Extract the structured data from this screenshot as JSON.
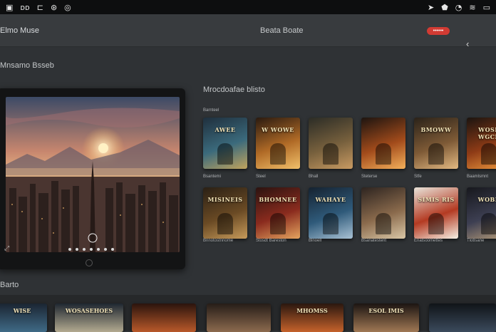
{
  "status_bar": {
    "left_glyphs": [
      "▣",
      "ᴅᴅ",
      "⊏",
      "⊛",
      "◎"
    ],
    "right_glyphs": [
      "➤",
      "⬟",
      "◔",
      "≋",
      "▭"
    ]
  },
  "header": {
    "app_title": "Elmo Muse",
    "center_title": "Beata Boate",
    "badge_label": "••••••"
  },
  "sections": {
    "top_title": "Mnsamo Bsseb",
    "grid_title": "Mrocdoafae blisto",
    "grid_subtitle": "Barnteel",
    "bottom_title": "Barto"
  },
  "row1": [
    {
      "title": "AWEE",
      "caption": "Bsantemi",
      "colors": [
        "#1f2f3d",
        "#3b6a7c",
        "#c0a35d"
      ]
    },
    {
      "title": "W WOWE",
      "caption": "Steel",
      "colors": [
        "#2a1a10",
        "#b06a26",
        "#f1c06a"
      ]
    },
    {
      "title": "",
      "caption": "Bhall",
      "colors": [
        "#2b2c26",
        "#77603d",
        "#c89a62"
      ]
    },
    {
      "title": "",
      "caption": "Steterse",
      "colors": [
        "#1d1410",
        "#a24b1b",
        "#f3b05b"
      ]
    },
    {
      "title": "BMOWW",
      "caption": "Stfe",
      "colors": [
        "#2a2219",
        "#7e5a36",
        "#e2b982"
      ]
    },
    {
      "title": "WOSE WGCE",
      "caption": "Baamlsmnt",
      "colors": [
        "#1b1410",
        "#8e3b16",
        "#ef9a3e"
      ]
    }
  ],
  "row2": [
    {
      "title": "MISINEIS",
      "caption": "Bnnotostnnome",
      "colors": [
        "#2a2015",
        "#6a4a24",
        "#c69a5a"
      ]
    },
    {
      "title": "BHOMNEE",
      "caption": "Stosdt Bareston",
      "colors": [
        "#2b1310",
        "#8a2b1e",
        "#e4a45f"
      ]
    },
    {
      "title": "WAHAYE",
      "caption": "Blnoell",
      "colors": [
        "#152230",
        "#2f5a7a",
        "#a9c2d4"
      ]
    },
    {
      "title": "",
      "caption": "Bsanatestent",
      "colors": [
        "#2d2420",
        "#8a6a4c",
        "#d9c7a6"
      ]
    },
    {
      "title": "SIMIS RIS",
      "caption": "Enatsoomettes",
      "colors": [
        "#e9e4da",
        "#b43a22",
        "#f6f1e5"
      ]
    },
    {
      "title": "WOBE",
      "caption": "Tlotlsane",
      "colors": [
        "#17181d",
        "#3d3f52",
        "#b99e7a"
      ]
    }
  ],
  "bottom_row": [
    {
      "title": "WISE",
      "colors": [
        "#1b2532",
        "#3f6a86"
      ]
    },
    {
      "title": "WOSASEHOES",
      "colors": [
        "#1f2731",
        "#b3aa90"
      ]
    },
    {
      "title": "",
      "colors": [
        "#2b140d",
        "#b9592a"
      ]
    },
    {
      "title": "",
      "colors": [
        "#261d18",
        "#8c6a4e"
      ]
    },
    {
      "title": "MHOMSS",
      "colors": [
        "#2a170f",
        "#c5622b"
      ]
    },
    {
      "title": "ESOL IMIS",
      "colors": [
        "#1c1512",
        "#a07854"
      ]
    },
    {
      "title": "",
      "colors": [
        "#101418",
        "#3b4a5c"
      ]
    }
  ]
}
